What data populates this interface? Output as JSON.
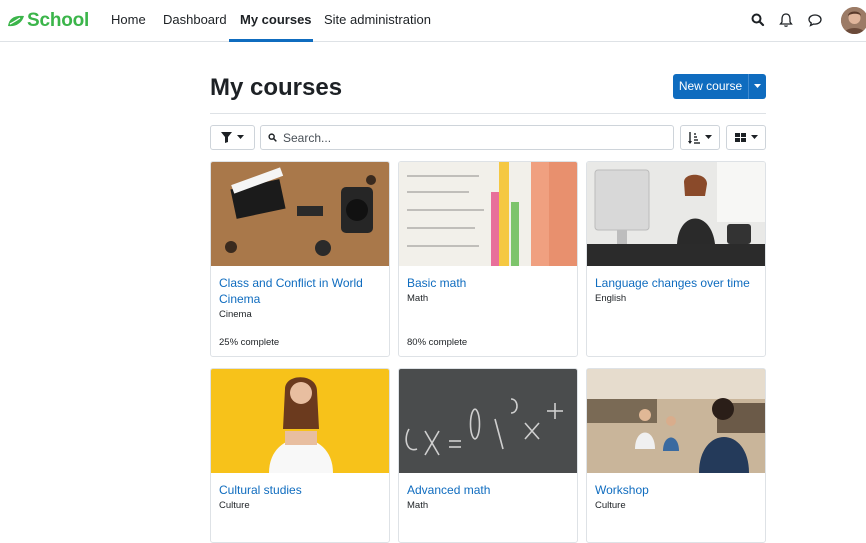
{
  "brand": {
    "name": "School"
  },
  "nav": {
    "items": [
      {
        "label": "Home"
      },
      {
        "label": "Dashboard"
      },
      {
        "label": "My courses"
      },
      {
        "label": "Site administration"
      }
    ]
  },
  "header": {
    "title": "My courses",
    "new_course_label": "New course"
  },
  "filters": {
    "search_placeholder": "Search..."
  },
  "courses": [
    {
      "title": "Class and Conflict in World Cinema",
      "category": "Cinema",
      "progress": "25% complete"
    },
    {
      "title": "Basic math",
      "category": "Math",
      "progress": "80% complete"
    },
    {
      "title": "Language changes over time",
      "category": "English",
      "progress": ""
    },
    {
      "title": "Cultural studies",
      "category": "Culture",
      "progress": ""
    },
    {
      "title": "Advanced math",
      "category": "Math",
      "progress": ""
    },
    {
      "title": "Workshop",
      "category": "Culture",
      "progress": ""
    }
  ],
  "colors": {
    "brand": "#3bb54a",
    "primary": "#0f6cbf",
    "link": "#0f6cbf"
  },
  "icons": [
    "leaf-icon",
    "search-icon",
    "bell-icon",
    "chat-icon",
    "avatar",
    "filter-icon",
    "sort-icon",
    "grid-icon",
    "chevron-down-icon"
  ]
}
